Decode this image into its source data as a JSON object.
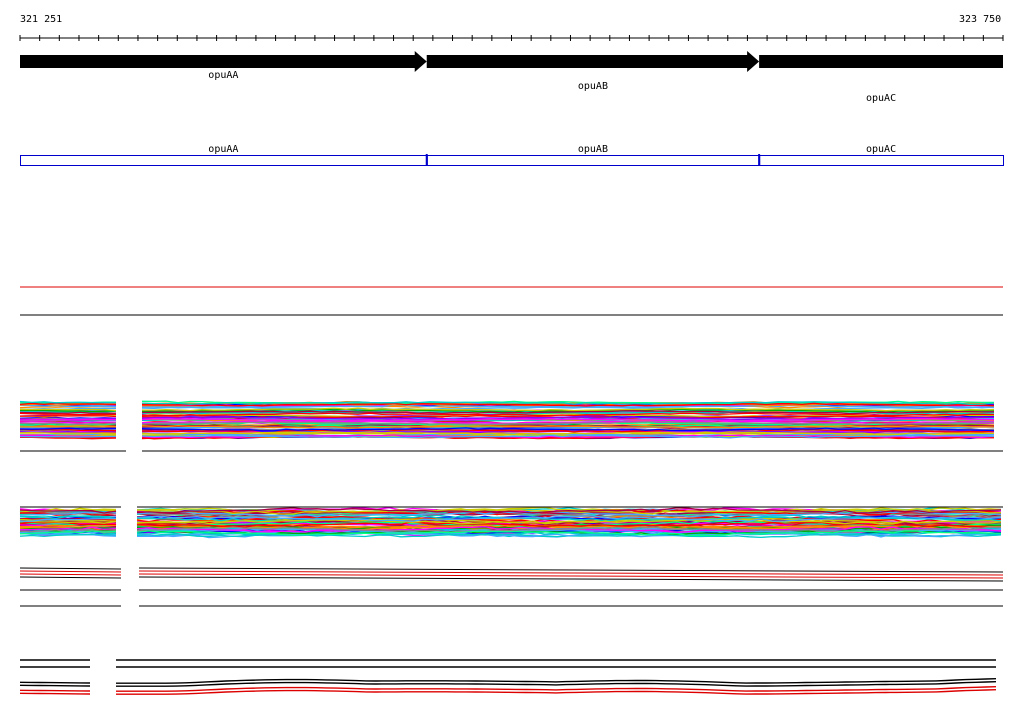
{
  "coordinates": {
    "start": "321 251",
    "end": "323 750"
  },
  "genes": [
    {
      "name": "opuAA",
      "start": 321251,
      "end": 322285
    },
    {
      "name": "opuAB",
      "start": 322285,
      "end": 323130
    },
    {
      "name": "opuAC",
      "start": 323130,
      "end": 323750
    }
  ],
  "colors": {
    "arrow": "#000000",
    "operon_box": "#0000cc",
    "red_track": "#dd0000",
    "profile_palette": [
      "#ff0000",
      "#00aa00",
      "#0000ff",
      "#ff00ff",
      "#00cccc",
      "#cccc00",
      "#ff8800",
      "#8800ff",
      "#00ff88",
      "#888888",
      "#aa0044",
      "#44aaff"
    ]
  }
}
